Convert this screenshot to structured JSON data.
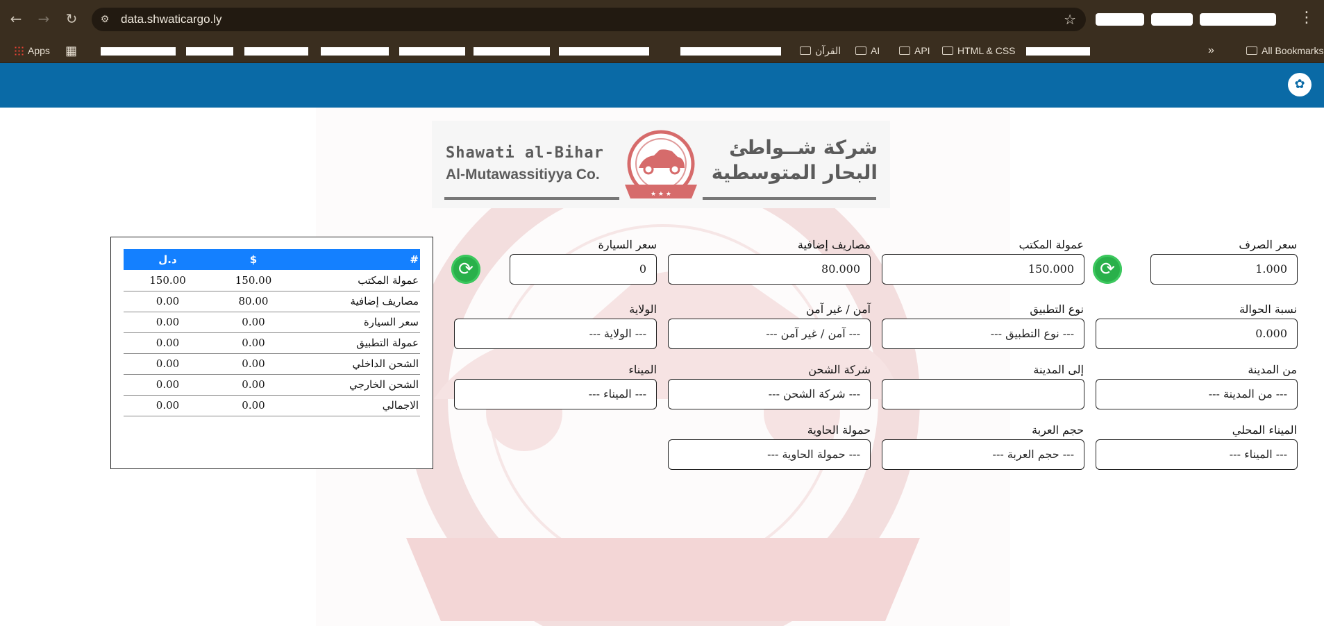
{
  "browser": {
    "url": "data.shwaticargo.ly",
    "bookmarks": {
      "apps": "Apps",
      "quran": "القرآن",
      "ai": "AI",
      "api": "API",
      "html_css": "HTML & CSS",
      "all_bookmarks": "All Bookmarks"
    }
  },
  "banner": {
    "english_line1": "Shawati al-Bihar",
    "english_line2": "Al-Mutawassitiyya Co.",
    "arabic_line1": "شركة شــواطئ",
    "arabic_line2": "البحار المتوسطية"
  },
  "form": {
    "exchange_rate": {
      "label": "سعر الصرف",
      "value": "1.000"
    },
    "office_commission": {
      "label": "عمولة المكتب",
      "value": "150.000"
    },
    "extra_expenses": {
      "label": "مصاريف إضافية",
      "value": "80.000"
    },
    "car_price": {
      "label": "سعر السيارة",
      "value": "0"
    },
    "transfer_rate": {
      "label": "نسبة الحوالة",
      "value": "0.000"
    },
    "app_type": {
      "label": "نوع التطبيق",
      "placeholder": "--- نوع التطبيق ---"
    },
    "safe_unsafe": {
      "label": "آمن / غير آمن",
      "placeholder": "--- آمن / غير آمن ---"
    },
    "state": {
      "label": "الولاية",
      "placeholder": "--- الولاية ---"
    },
    "from_city": {
      "label": "من المدينة",
      "placeholder": "--- من المدينة ---"
    },
    "to_city": {
      "label": "إلى المدينة",
      "placeholder": ""
    },
    "shipping_company": {
      "label": "شركة الشحن",
      "placeholder": "--- شركة الشحن ---"
    },
    "port": {
      "label": "الميناء",
      "placeholder": "--- الميناء ---"
    },
    "local_port": {
      "label": "الميناء المحلي",
      "placeholder": "--- الميناء ---"
    },
    "vehicle_size": {
      "label": "حجم العربة",
      "placeholder": "--- حجم العربة ---"
    },
    "container_load": {
      "label": "حمولة الحاوية",
      "placeholder": "--- حمولة الحاوية ---"
    }
  },
  "summary": {
    "headers": {
      "name": "#",
      "usd": "$",
      "lyd": "د.ل"
    },
    "rows": [
      {
        "name": "عمولة المكتب",
        "usd": "150.00",
        "lyd": "150.00"
      },
      {
        "name": "مصاريف إضافية",
        "usd": "80.00",
        "lyd": "0.00"
      },
      {
        "name": "سعر السيارة",
        "usd": "0.00",
        "lyd": "0.00"
      },
      {
        "name": "عمولة التطبيق",
        "usd": "0.00",
        "lyd": "0.00"
      },
      {
        "name": "الشحن الداخلي",
        "usd": "0.00",
        "lyd": "0.00"
      },
      {
        "name": "الشحن الخارجي",
        "usd": "0.00",
        "lyd": "0.00"
      },
      {
        "name": "الاجمالي",
        "usd": "0.00",
        "lyd": "0.00"
      }
    ]
  },
  "colors": {
    "header_blue": "#0a6aa6",
    "table_header": "#1480ff",
    "refresh_green": "#29b04a"
  },
  "icons": {
    "back": "arrow-left-icon",
    "forward": "arrow-right-icon",
    "reload": "reload-icon",
    "refresh": "refresh-icon"
  }
}
